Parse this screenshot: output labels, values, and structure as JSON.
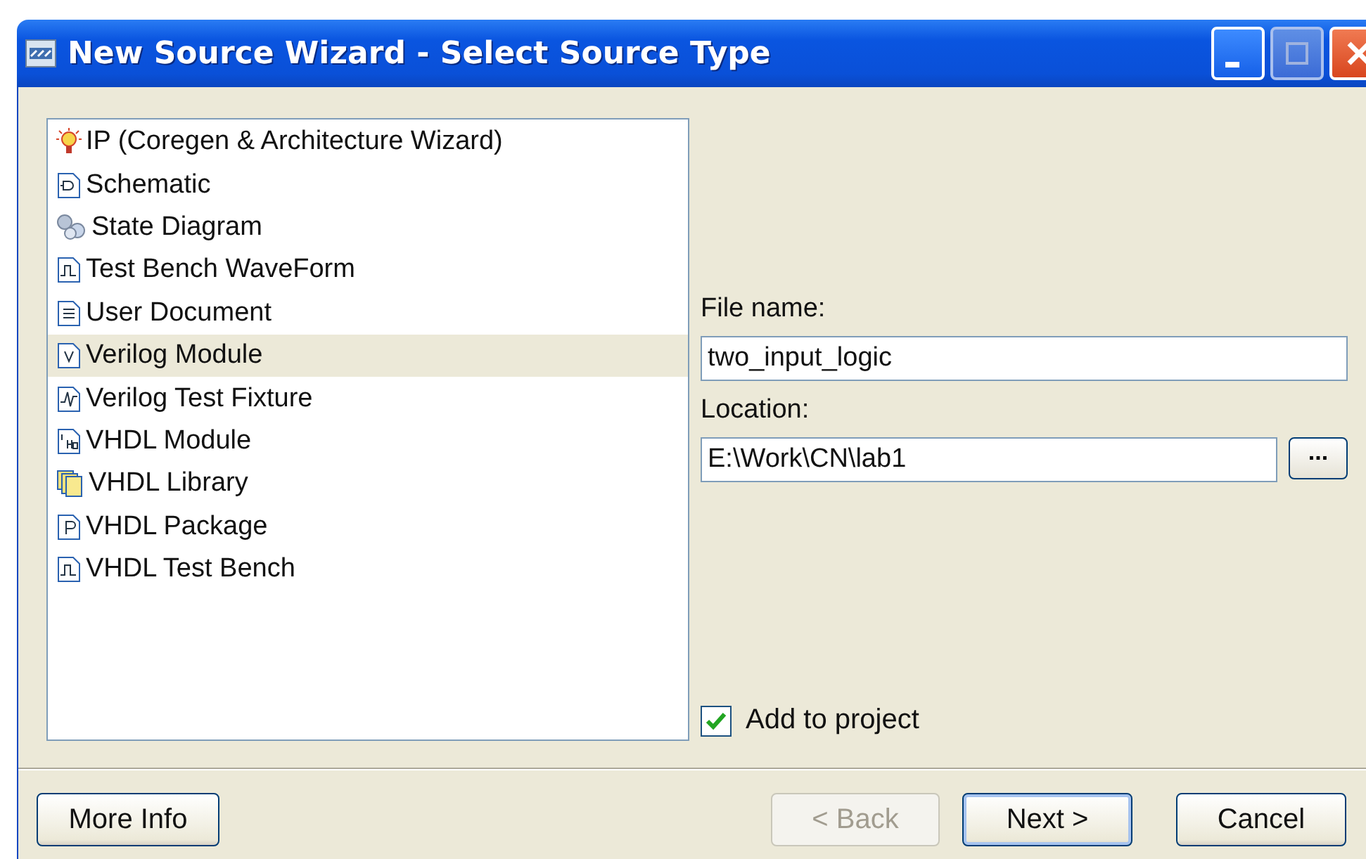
{
  "window": {
    "title": "New Source Wizard - Select Source Type"
  },
  "source_types": [
    {
      "label": "IP (Coregen & Architecture Wizard)",
      "kind": "ip",
      "selected": false
    },
    {
      "label": "Schematic",
      "kind": "schematic",
      "selected": false
    },
    {
      "label": "State Diagram",
      "kind": "state",
      "selected": false
    },
    {
      "label": "Test Bench WaveForm",
      "kind": "waveform",
      "selected": false
    },
    {
      "label": "User Document",
      "kind": "document",
      "selected": false
    },
    {
      "label": "Verilog Module",
      "kind": "verilog",
      "selected": true
    },
    {
      "label": "Verilog Test Fixture",
      "kind": "fixture",
      "selected": false
    },
    {
      "label": "VHDL Module",
      "kind": "vhdl",
      "selected": false
    },
    {
      "label": "VHDL Library",
      "kind": "library",
      "selected": false
    },
    {
      "label": "VHDL Package",
      "kind": "package",
      "selected": false
    },
    {
      "label": "VHDL Test Bench",
      "kind": "testbench",
      "selected": false
    }
  ],
  "file_name": {
    "label": "File name:",
    "value": "two_input_logic"
  },
  "location": {
    "label": "Location:",
    "value": "E:\\Work\\CN\\lab1",
    "browse": "..."
  },
  "add_to_project": {
    "label": "Add to project",
    "checked": true
  },
  "buttons": [
    {
      "label": "More Info",
      "disabled": false,
      "default": false
    },
    {
      "label": "< Back",
      "disabled": true,
      "default": false
    },
    {
      "label": "Next >",
      "disabled": false,
      "default": true
    },
    {
      "label": "Cancel",
      "disabled": false,
      "default": false
    }
  ]
}
